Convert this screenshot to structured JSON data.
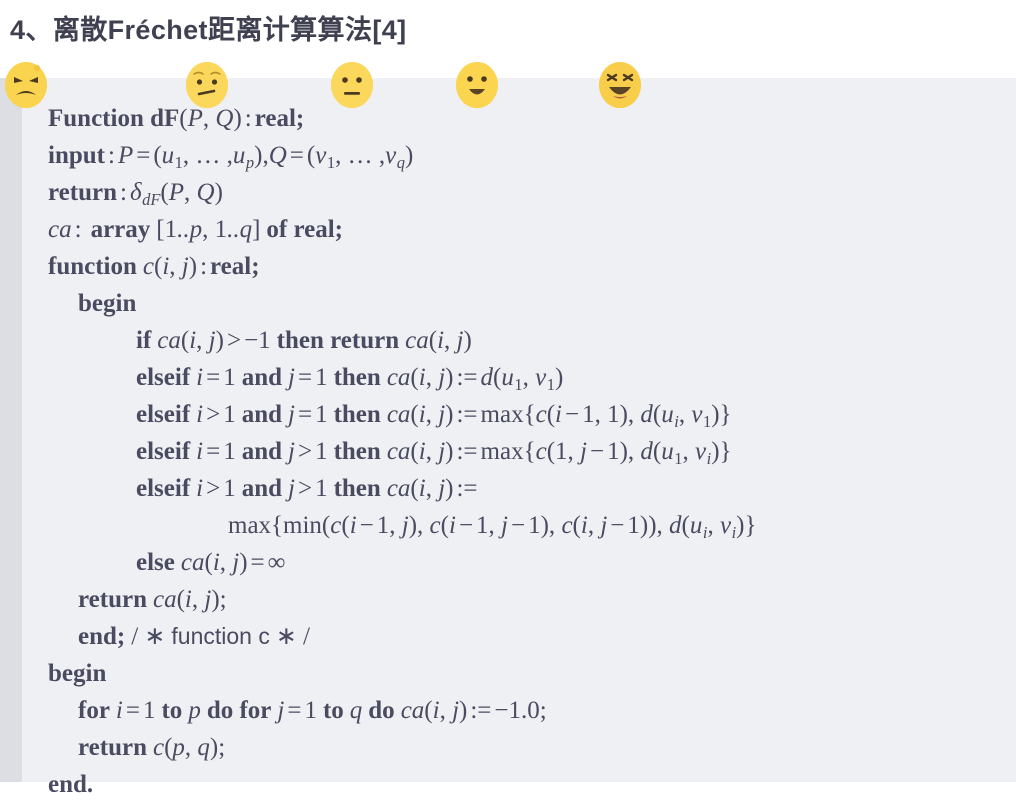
{
  "heading": {
    "text": "4、离散Fréchet距离计算算法[4]"
  },
  "rating": {
    "name": "emoji-rating-row",
    "faces": [
      {
        "id": "angry",
        "label": "angry-face",
        "color": "#fad44e"
      },
      {
        "id": "worried",
        "label": "worried-face",
        "color": "#fbd75c"
      },
      {
        "id": "neutral",
        "label": "neutral-face",
        "color": "#fbd75c"
      },
      {
        "id": "smiling",
        "label": "smiling-face",
        "color": "#fbd450"
      },
      {
        "id": "laughing",
        "label": "laughing-face",
        "color": "#f7cd4a"
      }
    ]
  },
  "code": {
    "background": "#eef0f4",
    "gutter_color": "#dcdee3",
    "text_color": "#4a4b60",
    "lines": [
      {
        "indent": 0,
        "plain": "Function dF(P, Q) : real;"
      },
      {
        "indent": 0,
        "plain": "input : P = (u₁, …, u_p), Q = (v₁, …, v_q)"
      },
      {
        "indent": 0,
        "plain": "return :δ_dF(P, Q)"
      },
      {
        "indent": 0,
        "plain": "ca :  array [1..p, 1..q] of real;"
      },
      {
        "indent": 0,
        "plain": "function c(i, j) : real;"
      },
      {
        "indent": 1,
        "plain": "begin"
      },
      {
        "indent": 2,
        "plain": "if ca(i, j) > −1 then return ca(i, j)"
      },
      {
        "indent": 2,
        "plain": "elseif i = 1 and j = 1 then ca(i, j) := d(u₁, v₁)"
      },
      {
        "indent": 2,
        "plain": "elseif i > 1 and j = 1 then ca(i, j) := max{c(i − 1, 1), d(u_i, v₁)}"
      },
      {
        "indent": 2,
        "plain": "elseif i = 1 and j > 1 then ca(i, j) := max{c(1, j − 1), d(u₁, v_i)}"
      },
      {
        "indent": 2,
        "plain": "elseif i > 1 and j > 1 then ca(i, j) :="
      },
      {
        "indent": 3,
        "plain": "max{min(c(i − 1, j), c(i − 1, j − 1), c(i, j − 1)), d(u_i, v_i)}"
      },
      {
        "indent": 2,
        "plain": "else ca(i, j) = ∞"
      },
      {
        "indent": 1,
        "plain": "return ca(i, j);"
      },
      {
        "indent": 1,
        "plain": "end; / ∗ function c ∗ /"
      },
      {
        "indent": 0,
        "plain": "begin"
      },
      {
        "indent": 1,
        "plain": "for i = 1 to p do for j = 1 to q do ca(i, j) := −1.0;"
      },
      {
        "indent": 1,
        "plain": "return c(p, q);"
      },
      {
        "indent": 0,
        "plain": "end."
      }
    ]
  }
}
